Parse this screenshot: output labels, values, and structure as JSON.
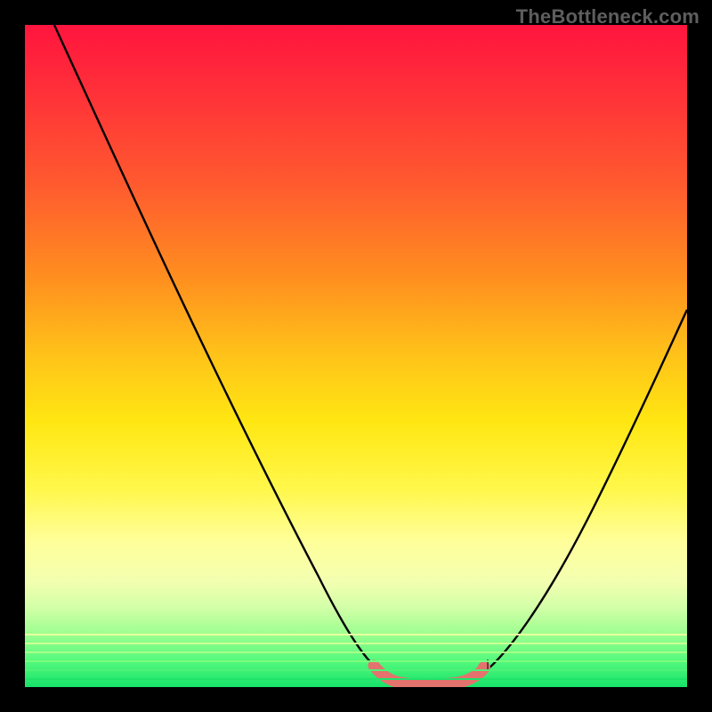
{
  "watermark": "TheBottleneck.com",
  "chart_data": {
    "type": "line",
    "title": "",
    "xlabel": "",
    "ylabel": "",
    "xlim": [
      0,
      100
    ],
    "ylim": [
      0,
      100
    ],
    "background_gradient": {
      "orientation": "vertical",
      "stops": [
        {
          "pct": 0,
          "color": "#ff153e"
        },
        {
          "pct": 24,
          "color": "#ff5a2f"
        },
        {
          "pct": 50,
          "color": "#ffc319"
        },
        {
          "pct": 70,
          "color": "#fff74a"
        },
        {
          "pct": 88,
          "color": "#d2ffa8"
        },
        {
          "pct": 100,
          "color": "#17e36a"
        }
      ]
    },
    "series": [
      {
        "name": "bottleneck-curve",
        "color": "#000000",
        "x": [
          0,
          5,
          10,
          15,
          20,
          25,
          30,
          35,
          40,
          45,
          50,
          53,
          56,
          60,
          63,
          66,
          70,
          75,
          80,
          85,
          90,
          95,
          100
        ],
        "y": [
          100,
          93,
          85,
          77,
          69,
          61,
          52,
          44,
          35,
          26,
          17,
          10,
          4,
          1,
          0,
          0,
          1,
          6,
          14,
          24,
          35,
          46,
          57
        ]
      },
      {
        "name": "floor-highlight",
        "color": "#e4736e",
        "x": [
          53,
          56,
          58,
          60,
          62,
          64,
          66,
          68,
          70
        ],
        "y": [
          3,
          1.5,
          0.8,
          0.5,
          0.4,
          0.4,
          0.6,
          1.2,
          2.5
        ]
      }
    ],
    "markers": [
      {
        "name": "endpoint-dot",
        "x": 70,
        "y": 2.5,
        "color": "#e4736e"
      }
    ]
  }
}
